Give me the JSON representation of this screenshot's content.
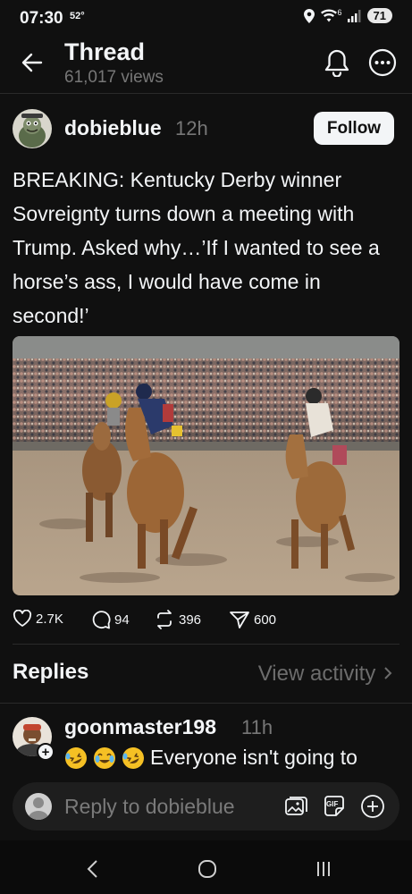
{
  "status_bar": {
    "time": "07:30",
    "temperature": "52°",
    "network": "6",
    "battery": "71"
  },
  "header": {
    "title": "Thread",
    "views": "61,017 views"
  },
  "post": {
    "username": "dobieblue",
    "time_ago": "12h",
    "follow_label": "Follow",
    "text": "BREAKING: Kentucky Derby winner Sovreignty turns down a meeting with Trump. Asked why…’If I wanted to see a horse’s ass, I would have come in second!’",
    "image_icon": "horse-race-photo",
    "stats": {
      "likes": "2.7K",
      "comments": "94",
      "reposts": "396",
      "shares": "600"
    }
  },
  "replies": {
    "title": "Replies",
    "view_activity": "View activity",
    "items": [
      {
        "username": "goonmaster198",
        "time_ago": "11h",
        "emojis": [
          "rolling-on-floor-laughing",
          "tears-of-joy",
          "rolling-on-floor-laughing"
        ],
        "text": "Everyone isn't going to"
      }
    ]
  },
  "reply_bar": {
    "placeholder": "Reply to dobieblue",
    "gif_label": "GIF"
  },
  "colors": {
    "background": "#101010",
    "text": "#f3f5f7",
    "muted": "#777777",
    "input_bg": "#1e1e1e"
  }
}
